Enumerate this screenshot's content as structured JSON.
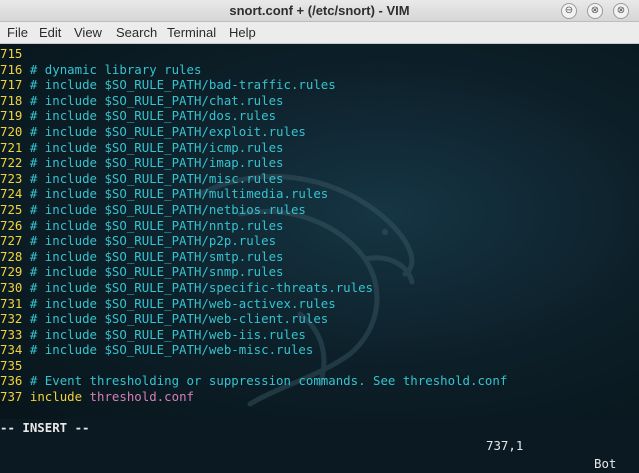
{
  "window": {
    "title": "snort.conf + (/etc/snort) - VIM",
    "minimize_glyph": "⊖",
    "maximize_glyph": "⊗",
    "close_glyph": "⊗"
  },
  "menubar": [
    "File",
    "Edit",
    "View",
    "Search",
    "Terminal",
    "Help"
  ],
  "editor": {
    "lines": [
      {
        "num": "715",
        "kind": "blank",
        "text": ""
      },
      {
        "num": "716",
        "kind": "comment",
        "text": "# dynamic library rules"
      },
      {
        "num": "717",
        "kind": "comment",
        "text": "# include $SO_RULE_PATH/bad-traffic.rules"
      },
      {
        "num": "718",
        "kind": "comment",
        "text": "# include $SO_RULE_PATH/chat.rules"
      },
      {
        "num": "719",
        "kind": "comment",
        "text": "# include $SO_RULE_PATH/dos.rules"
      },
      {
        "num": "720",
        "kind": "comment",
        "text": "# include $SO_RULE_PATH/exploit.rules"
      },
      {
        "num": "721",
        "kind": "comment",
        "text": "# include $SO_RULE_PATH/icmp.rules"
      },
      {
        "num": "722",
        "kind": "comment",
        "text": "# include $SO_RULE_PATH/imap.rules"
      },
      {
        "num": "723",
        "kind": "comment",
        "text": "# include $SO_RULE_PATH/misc.rules"
      },
      {
        "num": "724",
        "kind": "comment",
        "text": "# include $SO_RULE_PATH/multimedia.rules"
      },
      {
        "num": "725",
        "kind": "comment",
        "text": "# include $SO_RULE_PATH/netbios.rules"
      },
      {
        "num": "726",
        "kind": "comment",
        "text": "# include $SO_RULE_PATH/nntp.rules"
      },
      {
        "num": "727",
        "kind": "comment",
        "text": "# include $SO_RULE_PATH/p2p.rules"
      },
      {
        "num": "728",
        "kind": "comment",
        "text": "# include $SO_RULE_PATH/smtp.rules"
      },
      {
        "num": "729",
        "kind": "comment",
        "text": "# include $SO_RULE_PATH/snmp.rules"
      },
      {
        "num": "730",
        "kind": "comment",
        "text": "# include $SO_RULE_PATH/specific-threats.rules"
      },
      {
        "num": "731",
        "kind": "comment",
        "text": "# include $SO_RULE_PATH/web-activex.rules"
      },
      {
        "num": "732",
        "kind": "comment",
        "text": "# include $SO_RULE_PATH/web-client.rules"
      },
      {
        "num": "733",
        "kind": "comment",
        "text": "# include $SO_RULE_PATH/web-iis.rules"
      },
      {
        "num": "734",
        "kind": "comment",
        "text": "# include $SO_RULE_PATH/web-misc.rules"
      },
      {
        "num": "735",
        "kind": "blank",
        "text": ""
      },
      {
        "num": "736",
        "kind": "comment",
        "text": "# Event thresholding or suppression commands. See threshold.conf"
      },
      {
        "num": "737",
        "kind": "include",
        "keyword": "include",
        "arg": "threshold.conf"
      }
    ]
  },
  "status": {
    "mode": "-- INSERT --",
    "position": "737,1",
    "scroll": "Bot"
  },
  "colors": {
    "line_number": "#f2d33a",
    "comment": "#35c3cf",
    "keyword": "#f2d33a",
    "string": "#d67fb9",
    "background": "#0c1e27"
  }
}
